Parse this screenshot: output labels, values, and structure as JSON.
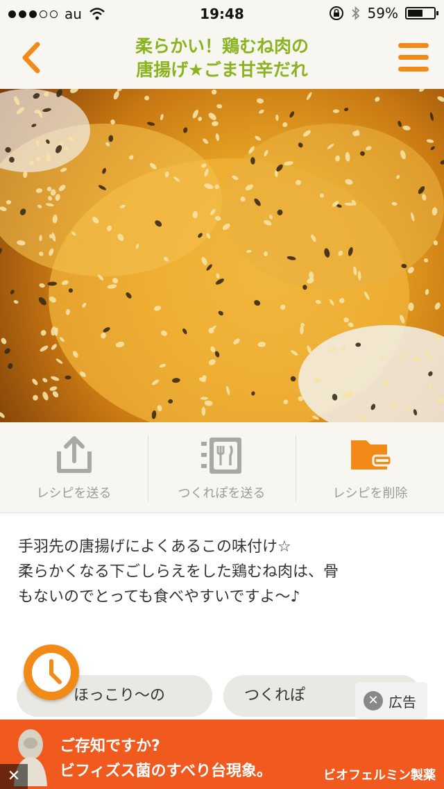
{
  "status_bar": {
    "carrier": "au",
    "time": "19:48",
    "battery": "59%",
    "battery_level": 0.59
  },
  "nav": {
    "title_line1": "柔らかい！鶏むね肉の",
    "title_line2": "唐揚げ★ごま甘辛だれ"
  },
  "actions": [
    {
      "label": "レシピを送る"
    },
    {
      "label": "つくれぽを送る"
    },
    {
      "label": "レシピを削除"
    }
  ],
  "description": {
    "line1": "手羽先の唐揚げによくあるこの味付け☆",
    "line2": "柔らかくなる下ごしらえをした鶏むね肉は、骨",
    "line3": "もないのでとっても食べやすいですよ〜♪"
  },
  "pills": {
    "first": "ほっこり〜の",
    "second": "つくれぽ"
  },
  "ad_tag": {
    "label": "広告"
  },
  "ad": {
    "line1": "ご存知ですか?",
    "line2": "ビフィズス菌のすべり台現象。",
    "brand": "ビオフェルミン製薬"
  },
  "colors": {
    "accent_orange": "#f28a18",
    "title_green": "#8ab31f",
    "ad_orange": "#f05a1f"
  }
}
